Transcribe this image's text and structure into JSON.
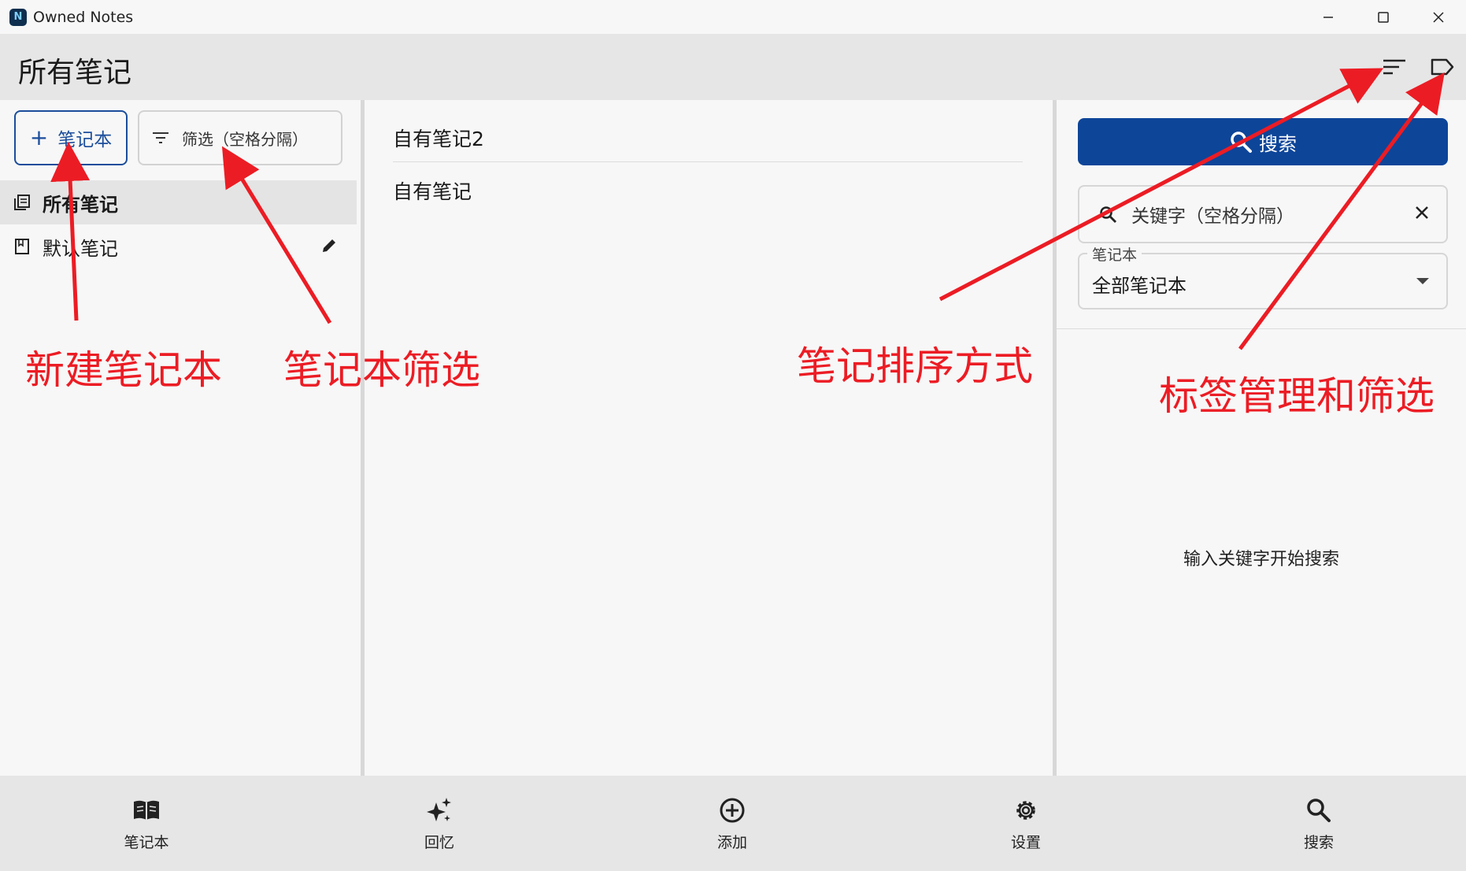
{
  "window": {
    "title": "Owned Notes",
    "app_icon_text": "N"
  },
  "appbar": {
    "title": "所有笔记"
  },
  "left": {
    "new_notebook_label": "笔记本",
    "filter_label": "筛选（空格分隔）",
    "notebooks": [
      {
        "label": "所有笔记",
        "selected": true
      },
      {
        "label": "默认笔记",
        "selected": false
      }
    ]
  },
  "middle": {
    "notes": [
      "自有笔记2",
      "自有笔记"
    ]
  },
  "right": {
    "search_button": "搜索",
    "keyword_placeholder": "关键字（空格分隔）",
    "notebook_select_label": "笔记本",
    "notebook_select_value": "全部笔记本",
    "hint": "输入关键字开始搜索"
  },
  "bottom_nav": [
    {
      "label": "笔记本",
      "icon": "book-icon"
    },
    {
      "label": "回忆",
      "icon": "sparkle-icon"
    },
    {
      "label": "添加",
      "icon": "add-circle-icon"
    },
    {
      "label": "设置",
      "icon": "gear-icon"
    },
    {
      "label": "搜索",
      "icon": "search-icon"
    }
  ],
  "annotations": {
    "new_notebook": "新建笔记本",
    "notebook_filter": "笔记本筛选",
    "sort": "笔记排序方式",
    "tags": "标签管理和筛选"
  },
  "colors": {
    "primary": "#0d4599",
    "outline_primary": "#1b4d9b",
    "annotation": "#ec1c24"
  }
}
